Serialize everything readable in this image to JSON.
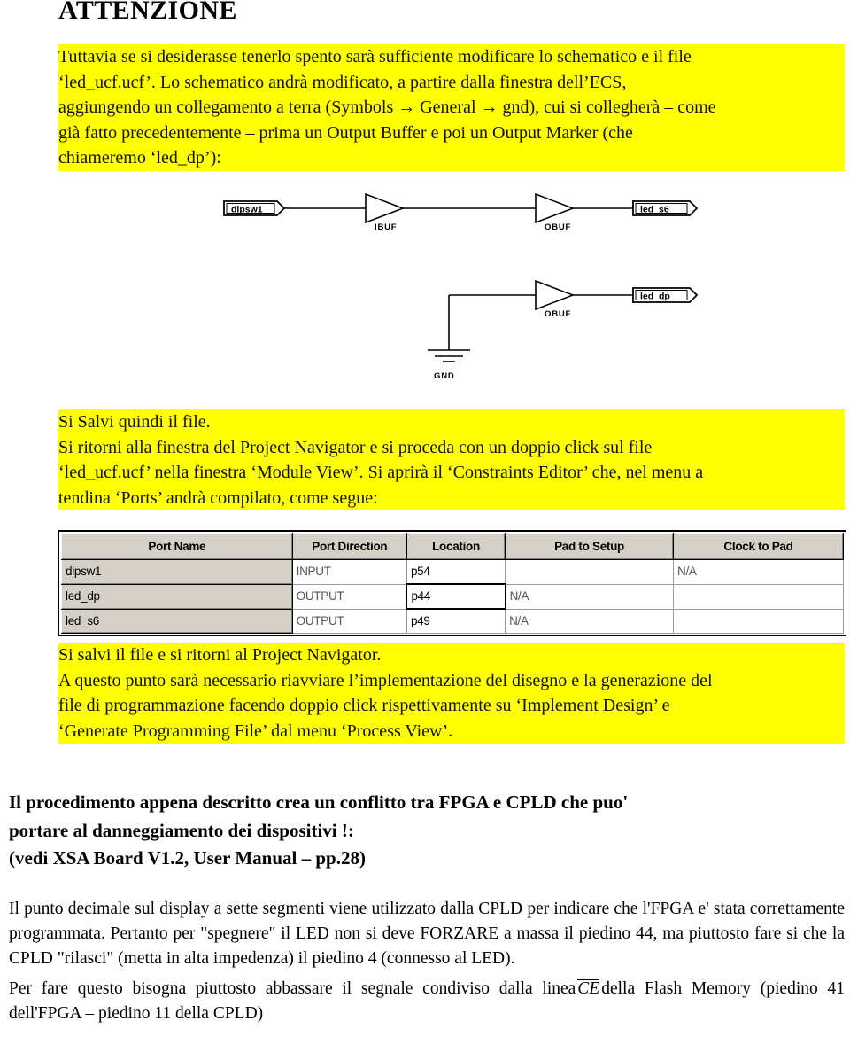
{
  "heading": "ATTENZIONE",
  "colors": {
    "highlight": "#ffff00",
    "text": "#000000",
    "table_header_bg": "#d4d0c8",
    "table_cell_text": "#555555"
  },
  "para1": {
    "line1": "Tuttavia se si desiderasse tenerlo spento sarà sufficiente modificare lo schematico e il file",
    "line2": "‘led_ucf.ucf’. Lo schematico andrà modificato, a partire dalla finestra dell’ECS,",
    "line3": "aggiungendo un collegamento a terra (Symbols → General → gnd), cui si collegherà – come",
    "line4": "già fatto precedentemente – prima un Output Buffer e poi un Output Marker (che",
    "line5": "chiameremo ‘led_dp’):"
  },
  "schematic": {
    "input_marker": "dipsw1",
    "ibuf_label": "IBUF",
    "obuf_top_label": "OBUF",
    "output_marker_top": "led_s6",
    "obuf_bottom_label": "OBUF",
    "output_marker_bottom": "led_dp",
    "gnd_label": "GND"
  },
  "para2": {
    "line1": "Si Salvi quindi il file.",
    "line2": "Si ritorni alla finestra del Project Navigator e si proceda con un doppio click sul file",
    "line3": "‘led_ucf.ucf’ nella finestra ‘Module View’. Si aprirà il ‘Constraints Editor’ che, nel menu a",
    "line4": "tendina ‘Ports’ andrà compilato, come segue:"
  },
  "table": {
    "headers": [
      "Port Name",
      "Port Direction",
      "Location",
      "Pad to Setup",
      "Clock to Pad"
    ],
    "rows": [
      {
        "port_name": "dipsw1",
        "port_direction": "INPUT",
        "location": "p54",
        "pad_to_setup": "",
        "clock_to_pad": "N/A",
        "selected_cell": null
      },
      {
        "port_name": "led_dp",
        "port_direction": "OUTPUT",
        "location": "p44",
        "pad_to_setup": "N/A",
        "clock_to_pad": "",
        "selected_cell": "location"
      },
      {
        "port_name": "led_s6",
        "port_direction": "OUTPUT",
        "location": "p49",
        "pad_to_setup": "N/A",
        "clock_to_pad": "",
        "selected_cell": null
      }
    ]
  },
  "para3": {
    "line1": "Si salvi il file e si ritorni al Project Navigator.",
    "line2": "A questo punto sarà necessario riavviare l’implementazione del disegno e la generazione del",
    "line3": "file di programmazione facendo doppio click rispettivamente su ‘Implement Design’ e",
    "line4": "‘Generate Programming File’ dal menu ‘Process View’."
  },
  "warning": {
    "line1": "Il procedimento appena descritto crea un conflitto tra FPGA e CPLD che puo'",
    "line2": "portare al danneggiamento dei dispositivi !:",
    "line3": "(vedi XSA Board V1.2, User Manual – pp.28)"
  },
  "closing": {
    "para1": "Il punto decimale sul display a sette segmenti viene utilizzato dalla CPLD per indicare che l'FPGA e' stata correttamente programmata. Pertanto per \"spegnere\" il LED non si deve FORZARE a massa il piedino 44, ma piuttosto fare si che la CPLD \"rilasci\" (metta in alta impedenza) il piedino 4 (connesso al LED).",
    "para2_before": "Per fare questo bisogna piuttosto abbassare il segnale condiviso dalla linea",
    "para2_signal": "CE",
    "para2_after": "della Flash Memory (piedino 41 dell'FPGA – piedino 11 della CPLD)"
  }
}
